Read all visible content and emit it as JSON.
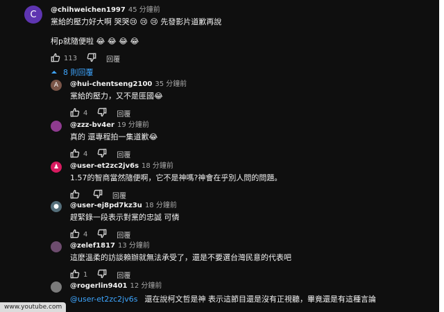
{
  "comment": {
    "avatar_letter": "C",
    "avatar_color": "#5e35b1",
    "handle": "@chihweichen1997",
    "time": "45 分鐘前",
    "line1": "黨給的壓力好大啊 哭哭😢 😢 😢  先發影片道歉再說",
    "line2": "柯p就隨便啦 😂 😂 😂 😂",
    "likes": "113",
    "reply_label": "回覆"
  },
  "replies_toggle": {
    "label": "8 則回覆"
  },
  "replies": [
    {
      "avatar": "A",
      "avatar_color": "#7a5548",
      "handle": "@hui-chentseng2100",
      "time": "35 分鐘前",
      "text": "黨給的壓力，又不是匪國😂",
      "likes": "4",
      "reply_label": "回覆"
    },
    {
      "avatar": "",
      "avatar_color": "#8e3b8f",
      "handle": "@zzz-bv4er",
      "time": "19 分鐘前",
      "text": "真的 還專程拍一集道歉😂",
      "likes": "4",
      "reply_label": "回覆"
    },
    {
      "avatar": "♟",
      "avatar_color": "#d81b60",
      "handle": "@user-et2zc2jv6s",
      "time": "18 分鐘前",
      "text": "1.57的智商當然隨便啊，它不是神嗎?神會在乎別人問的問題。",
      "likes": "",
      "reply_label": "回覆"
    },
    {
      "avatar": "●",
      "avatar_color": "#546e7a",
      "handle": "@user-ej8pd7kz3u",
      "time": "18 分鐘前",
      "text": "趕緊錄一段表示對黨的忠誠 可憐",
      "likes": "4",
      "reply_label": "回覆"
    },
    {
      "avatar": "",
      "avatar_color": "#6d4c6e",
      "handle": "@zelef1817",
      "time": "13 分鐘前",
      "text": "這麼溫柔的訪談賴辦就無法承受了，還是不要選台灣民意的代表吧",
      "likes": "1",
      "reply_label": "回覆"
    },
    {
      "avatar": "",
      "avatar_color": "#7b7b7b",
      "handle": "@rogerlin9401",
      "time": "12 分鐘前",
      "mention": "@user-et2zc2jv6s",
      "text": "還在說柯文哲是神 表示這節目還是沒有正視聽，畢竟還是有這種言論",
      "likes": "",
      "reply_label": ""
    }
  ],
  "status_bar": {
    "url": "www.youtube.com"
  }
}
